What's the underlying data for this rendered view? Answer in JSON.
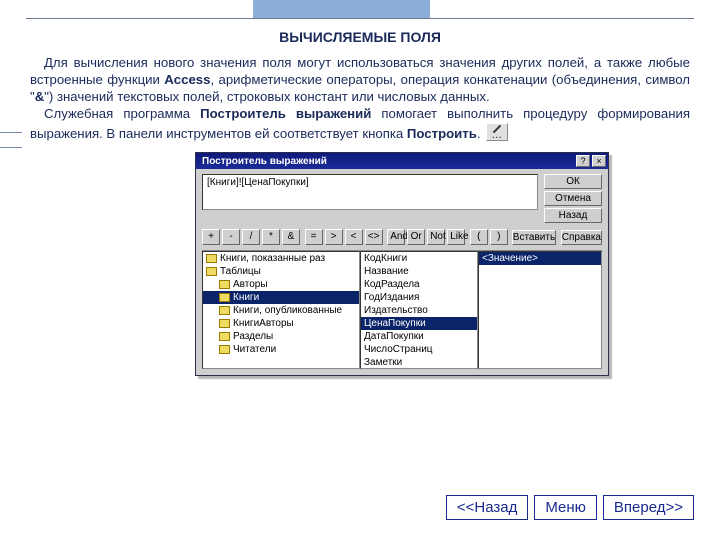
{
  "title": "ВЫЧИСЛЯЕМЫЕ ПОЛЯ",
  "paragraph": {
    "line1": "Для вычисления нового значения поля могут использоваться значения других полей, а также любые встроенные функции ",
    "bold1": "Access",
    "line2": ", арифметические операторы, операция конкатенации (объединения, символ \"",
    "amp": "&",
    "line3": "\") значений текстовых полей, строковых констант или числовых данных.",
    "line4": "Служебная программа ",
    "bold2": "Построитель выражений",
    "line5": " помогает выполнить процедуру формирования выражения. В панели инструментов ей соответствует кнопка ",
    "bold3": "Построить",
    "line6": "."
  },
  "dialog": {
    "title": "Построитель выражений",
    "expr": "[Книги]![ЦенаПокупки]",
    "buttons": {
      "ok": "ОК",
      "cancel": "Отмена",
      "undo": "Назад",
      "insert": "Вставить",
      "help": "Справка"
    },
    "ops": [
      "+",
      "-",
      "/",
      "*",
      "&",
      "=",
      ">",
      "<",
      "<>",
      "And",
      "Or",
      "Not",
      "Like",
      "(",
      ")"
    ],
    "tree": [
      {
        "label": "Книги, показанные раз",
        "level": 1
      },
      {
        "label": "Таблицы",
        "level": 1
      },
      {
        "label": "Авторы",
        "level": 2
      },
      {
        "label": "Книги",
        "level": 2,
        "selected": true
      },
      {
        "label": "Книги, опубликованные",
        "level": 2
      },
      {
        "label": "КнигиАвторы",
        "level": 2
      },
      {
        "label": "Разделы",
        "level": 2
      },
      {
        "label": "Читатели",
        "level": 2
      }
    ],
    "fields": [
      {
        "label": "КодКниги"
      },
      {
        "label": "Название"
      },
      {
        "label": "КодРаздела"
      },
      {
        "label": "ГодИздания"
      },
      {
        "label": "Издательство"
      },
      {
        "label": "ЦенаПокупки",
        "selected": true
      },
      {
        "label": "ДатаПокупки"
      },
      {
        "label": "ЧислоСтраниц"
      },
      {
        "label": "Заметки"
      }
    ],
    "value": "<Значение>"
  },
  "nav": {
    "back": "<<Назад",
    "menu": "Меню",
    "fwd": "Вперед>>"
  }
}
